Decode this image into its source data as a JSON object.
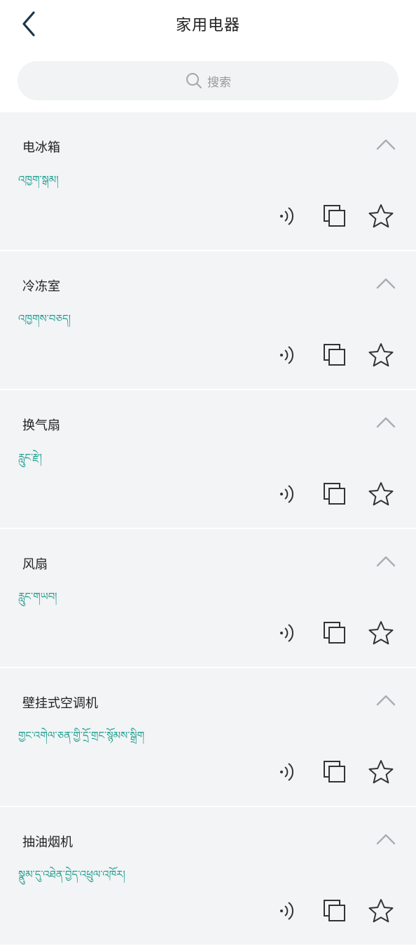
{
  "header": {
    "title": "家用电器"
  },
  "search": {
    "placeholder": "搜索"
  },
  "items": [
    {
      "zh": "电冰箱",
      "bo": "འཁྱག་སྒམ།"
    },
    {
      "zh": "冷冻室",
      "bo": "འཁྱགས་བཅད།"
    },
    {
      "zh": "换气扇",
      "bo": "རླུང་རྫེ།"
    },
    {
      "zh": "风扇",
      "bo": "རླུང་གཡབ།"
    },
    {
      "zh": "壁挂式空调机",
      "bo": "གྱང་འགེལ་ཅན་གྱི་དྲོ་གྲང་སྙོམས་སྒྲིག"
    },
    {
      "zh": "抽油烟机",
      "bo": "སྣུམ་དུ་འཐེན་བྱེད་འཕྲུལ་འཁོར།"
    }
  ],
  "icons": {
    "back": "chevron-left-icon",
    "search": "search-icon",
    "collapse": "chevron-up-icon",
    "speak": "sound-icon",
    "copy": "copy-icon",
    "favorite": "star-icon"
  },
  "colors": {
    "tibetan_text": "#1f9f8f",
    "card_bg": "#f3f4f6"
  }
}
